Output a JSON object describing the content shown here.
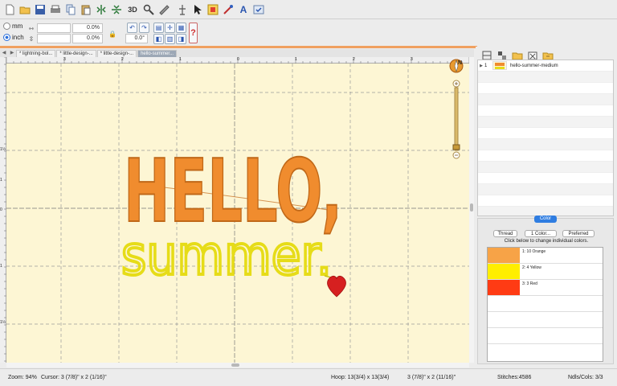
{
  "toolbar": {
    "icons": [
      "new-file",
      "open-folder",
      "save",
      "print",
      "copy",
      "paste",
      "flip-horizontal",
      "flip-vertical",
      "3d-view",
      "magnifier",
      "ruler",
      "hoop",
      "pointer",
      "design-properties",
      "stitch-editor",
      "lettering",
      "check-tool"
    ],
    "label_3d": "3D"
  },
  "options": {
    "unit_mm": "mm",
    "unit_inch": "inch",
    "scale_x": "0.0%",
    "scale_y": "0.0%",
    "rotate": "0.0°"
  },
  "tabs": [
    "* lightning-bol...",
    "* little-design-...",
    "* little-design-...",
    "hello-summer..."
  ],
  "rulers": {
    "h_labels": [
      "3",
      "2",
      "1",
      "0",
      "1",
      "2",
      "3"
    ],
    "v_labels": [
      "1½",
      "1",
      "0",
      "1",
      "1½"
    ]
  },
  "objects": {
    "rows": [
      {
        "arrow": "▶",
        "index": "1",
        "name": "hello-summer-medium"
      }
    ]
  },
  "color_panel": {
    "tab_label": "Color",
    "btn_thread": "Thread",
    "btn_color": "1 Color...",
    "btn_preferred": "Preferred",
    "hint": "Click below to change individual colors.",
    "colors": [
      {
        "label": "1: 10 Orange",
        "hex": "#f7a347"
      },
      {
        "label": "2: 4 Yellow",
        "hex": "#ffee00"
      },
      {
        "label": "3: 3 Red",
        "hex": "#ff3b14"
      }
    ]
  },
  "design": {
    "line1": "HELLO,",
    "line2": "summer.",
    "line1_color": "#f08c2e",
    "line2_color": "#e6dc18",
    "heart_color": "#d62020"
  },
  "status": {
    "zoom": "Zoom: 94%",
    "cursor": "Cursor: 3 (7/8)\" x 2 (1/16)\"",
    "hoop": "Hoop: 13(3/4) x 13(3/4)",
    "size": "3 (7/8)\" x 2 (11/16)\"",
    "stitches": "Stitches:4586",
    "ndls": "Ndls/Cols: 3/3"
  }
}
